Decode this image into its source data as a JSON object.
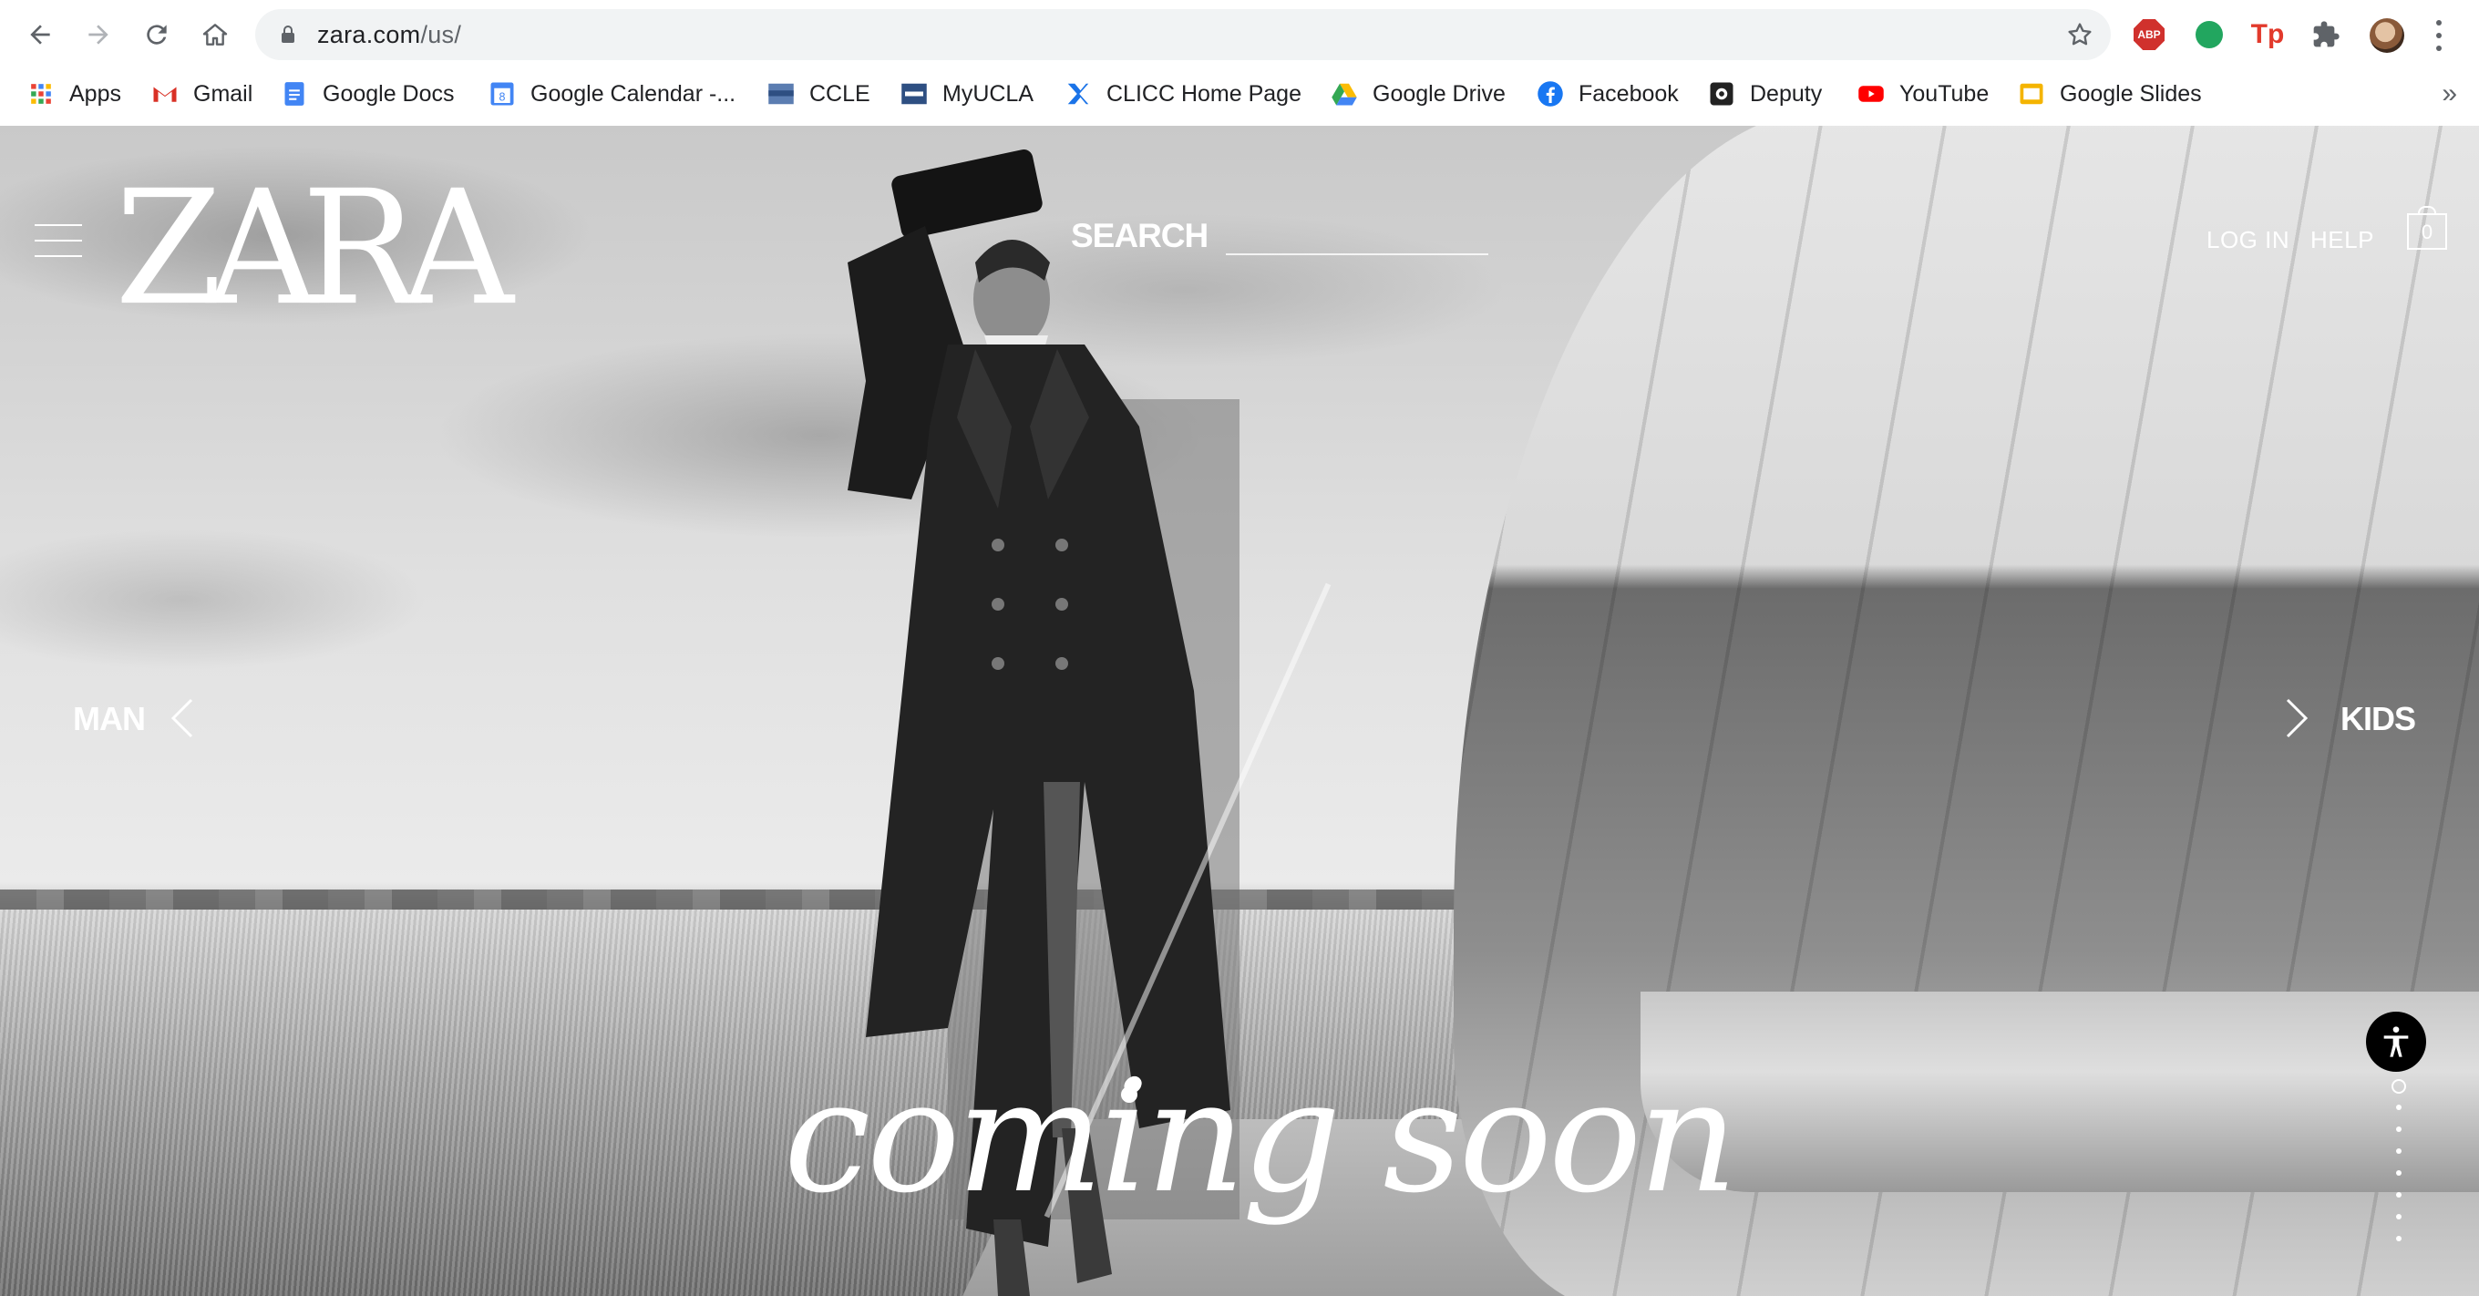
{
  "browser": {
    "url_host": "zara.com",
    "url_path": "/us/",
    "bookmarks": [
      {
        "label": "Apps",
        "icon": "apps-grid-icon"
      },
      {
        "label": "Gmail",
        "icon": "gmail-icon"
      },
      {
        "label": "Google Docs",
        "icon": "google-docs-icon"
      },
      {
        "label": "Google Calendar -...",
        "icon": "google-calendar-icon"
      },
      {
        "label": "CCLE",
        "icon": "ccle-icon"
      },
      {
        "label": "MyUCLA",
        "icon": "myucla-icon"
      },
      {
        "label": "CLICC Home Page",
        "icon": "clicc-icon"
      },
      {
        "label": "Google Drive",
        "icon": "google-drive-icon"
      },
      {
        "label": "Facebook",
        "icon": "facebook-icon"
      },
      {
        "label": "Deputy",
        "icon": "deputy-icon"
      },
      {
        "label": "YouTube",
        "icon": "youtube-icon"
      },
      {
        "label": "Google Slides",
        "icon": "google-slides-icon"
      }
    ],
    "overflow": "»",
    "extensions": {
      "abp": "ABP",
      "tp": "Tp"
    },
    "calendar_day": "8"
  },
  "page": {
    "logo": "ZARA",
    "search_label": "SEARCH",
    "login": "LOG IN",
    "help": "HELP",
    "cart_count": "0",
    "nav_left": "MAN",
    "nav_right": "KIDS",
    "headline": "coming soon",
    "colors": {
      "text": "#ffffff",
      "accent_dark": "#000000"
    }
  }
}
